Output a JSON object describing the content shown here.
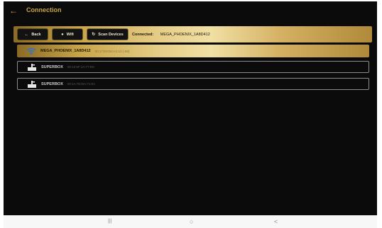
{
  "app": {
    "title": "Connection"
  },
  "toolbar": {
    "back_label": "Back",
    "wifi_label": "Wifi",
    "scan_label": "Scan Devices",
    "connected_label": "Connected:",
    "connected_value": "MEGA_PHOENIX_1A8D412"
  },
  "devices": [
    {
      "name": "MEGA_PHOENIX_1A8D412",
      "meta": "00:17:E9:D4:A1:12   (-58)",
      "icon": "wifi-device-icon",
      "active": true
    },
    {
      "name": "SUPERBOX",
      "meta": "00:12:6F:1A:77:D0",
      "icon": "bluetooth-device-icon",
      "active": false
    },
    {
      "name": "SUPERBOX",
      "meta": "00:1A:7D:DA:71:0A",
      "icon": "bluetooth-device-icon",
      "active": false
    }
  ],
  "nav": {
    "recents": "|||",
    "home": "○",
    "back": "<"
  },
  "colors": {
    "accent": "#c9a544",
    "background": "#0b0b0b",
    "gold_light": "#f1e0a4"
  }
}
